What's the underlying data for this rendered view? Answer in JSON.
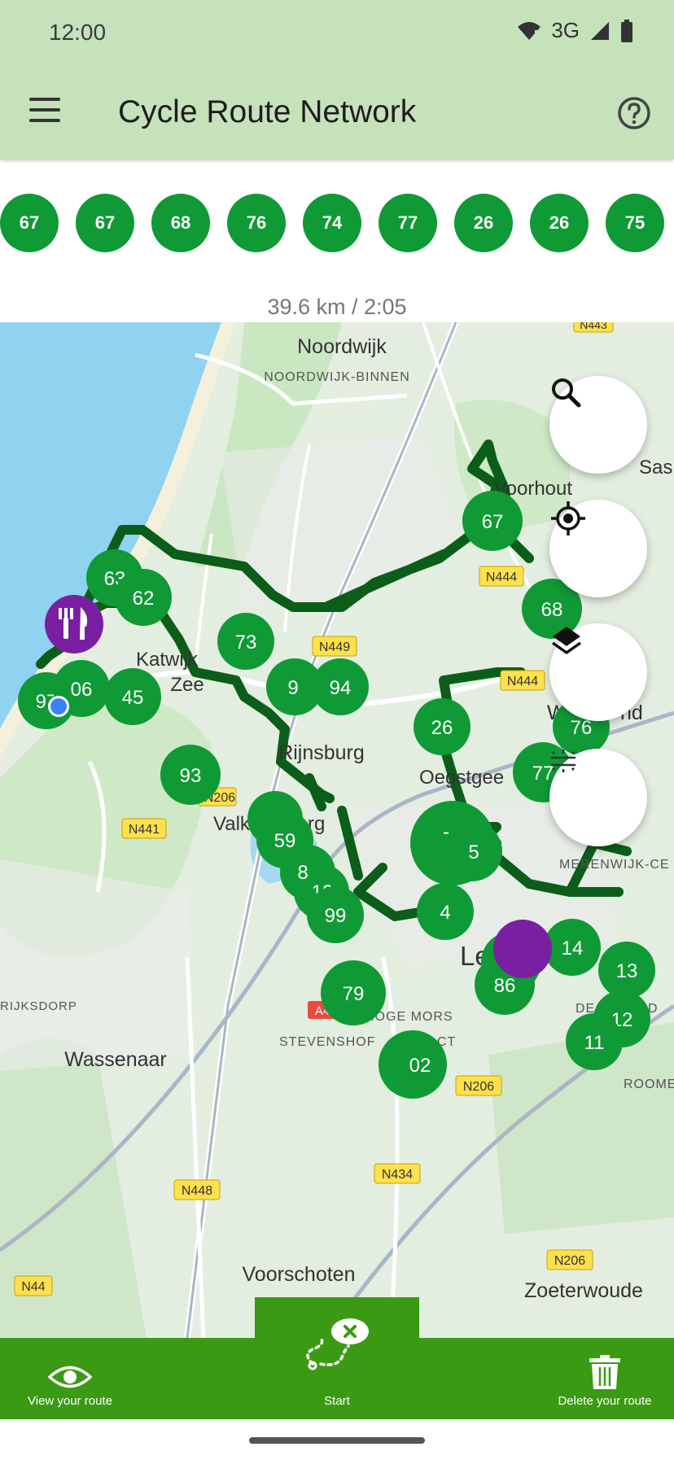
{
  "status": {
    "time": "12:00",
    "network": "3G"
  },
  "appbar": {
    "title": "Cycle Route Network"
  },
  "route_nodes": [
    "67",
    "67",
    "68",
    "76",
    "74",
    "77",
    "26",
    "26",
    "75"
  ],
  "summary": "39.6 km / 2:05",
  "map": {
    "places": [
      "Noordwijk",
      "NOORDWIJK-BINNEN",
      "Voorhout",
      "Sas",
      "Katwijk",
      "Zee",
      "Rijnsburg",
      "Oegstgee",
      "Valk",
      "rg",
      "Wassenaar",
      "Voorschoten",
      "Zoeterwoude",
      "RIJKSDORP",
      "HOGE MORS",
      "STEVENSHOF",
      "CT",
      "MERENWIJK-CE",
      "DE",
      "D",
      "ROOME",
      "nd",
      "Le",
      "W"
    ],
    "roads": [
      "N443",
      "N444",
      "N444",
      "N449",
      "N206",
      "N441",
      "N206",
      "N448",
      "N434",
      "N206",
      "N44",
      "A4"
    ],
    "nodes": [
      "67",
      "68",
      "63",
      "62",
      "73",
      "9",
      "94",
      "97",
      "06",
      "45",
      "93",
      "26",
      "77",
      "76",
      "59",
      "99",
      "79",
      "02",
      "5",
      "4",
      "86",
      "14",
      "13",
      "12",
      "11",
      "-",
      "8",
      "10"
    ]
  },
  "bottom_nav": {
    "view_label": "View your route",
    "start_label": "Start",
    "delete_label": "Delete your route"
  },
  "colors": {
    "node_green": "#0f9a35",
    "route_dark": "#0b5e19",
    "poi_purple": "#7b1fa2",
    "bar_green": "#3a9a14",
    "header_green": "#c5e2bb"
  }
}
